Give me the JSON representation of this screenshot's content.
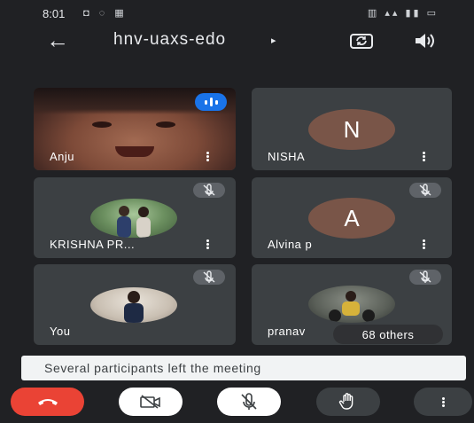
{
  "status_bar": {
    "time": "8:01",
    "notification_icons": "◘ ◌ ▦",
    "system_icons": "▥ ▴▴ ▮▮ ▭"
  },
  "header": {
    "meeting_code": "hnv-uaxs-edo",
    "meeting_code_arrow": "▸"
  },
  "participants": [
    {
      "name": "Anju",
      "video_on": true,
      "speaking": true
    },
    {
      "name": "NISHA",
      "avatar_letter": "N",
      "muted": false
    },
    {
      "name": "KRISHNA PR...",
      "muted": true
    },
    {
      "name": "Alvina p",
      "avatar_letter": "A",
      "muted": true
    },
    {
      "name": "You",
      "muted": true
    },
    {
      "name": "pranav",
      "muted": true
    }
  ],
  "others_badge": "68 others",
  "toast": {
    "message": "Several participants left the meeting"
  },
  "controls": {
    "end_call_icon": "phone-hangup-icon",
    "camera_icon": "camera-off-icon",
    "mic_icon": "mic-off-icon",
    "hand_icon": "raise-hand-icon",
    "more_icon": "more-vert-icon"
  },
  "colors": {
    "background": "#202124",
    "tile": "#3c4043",
    "end_call": "#ea4335",
    "speaking": "#1a73e8",
    "avatar": "#795548"
  }
}
